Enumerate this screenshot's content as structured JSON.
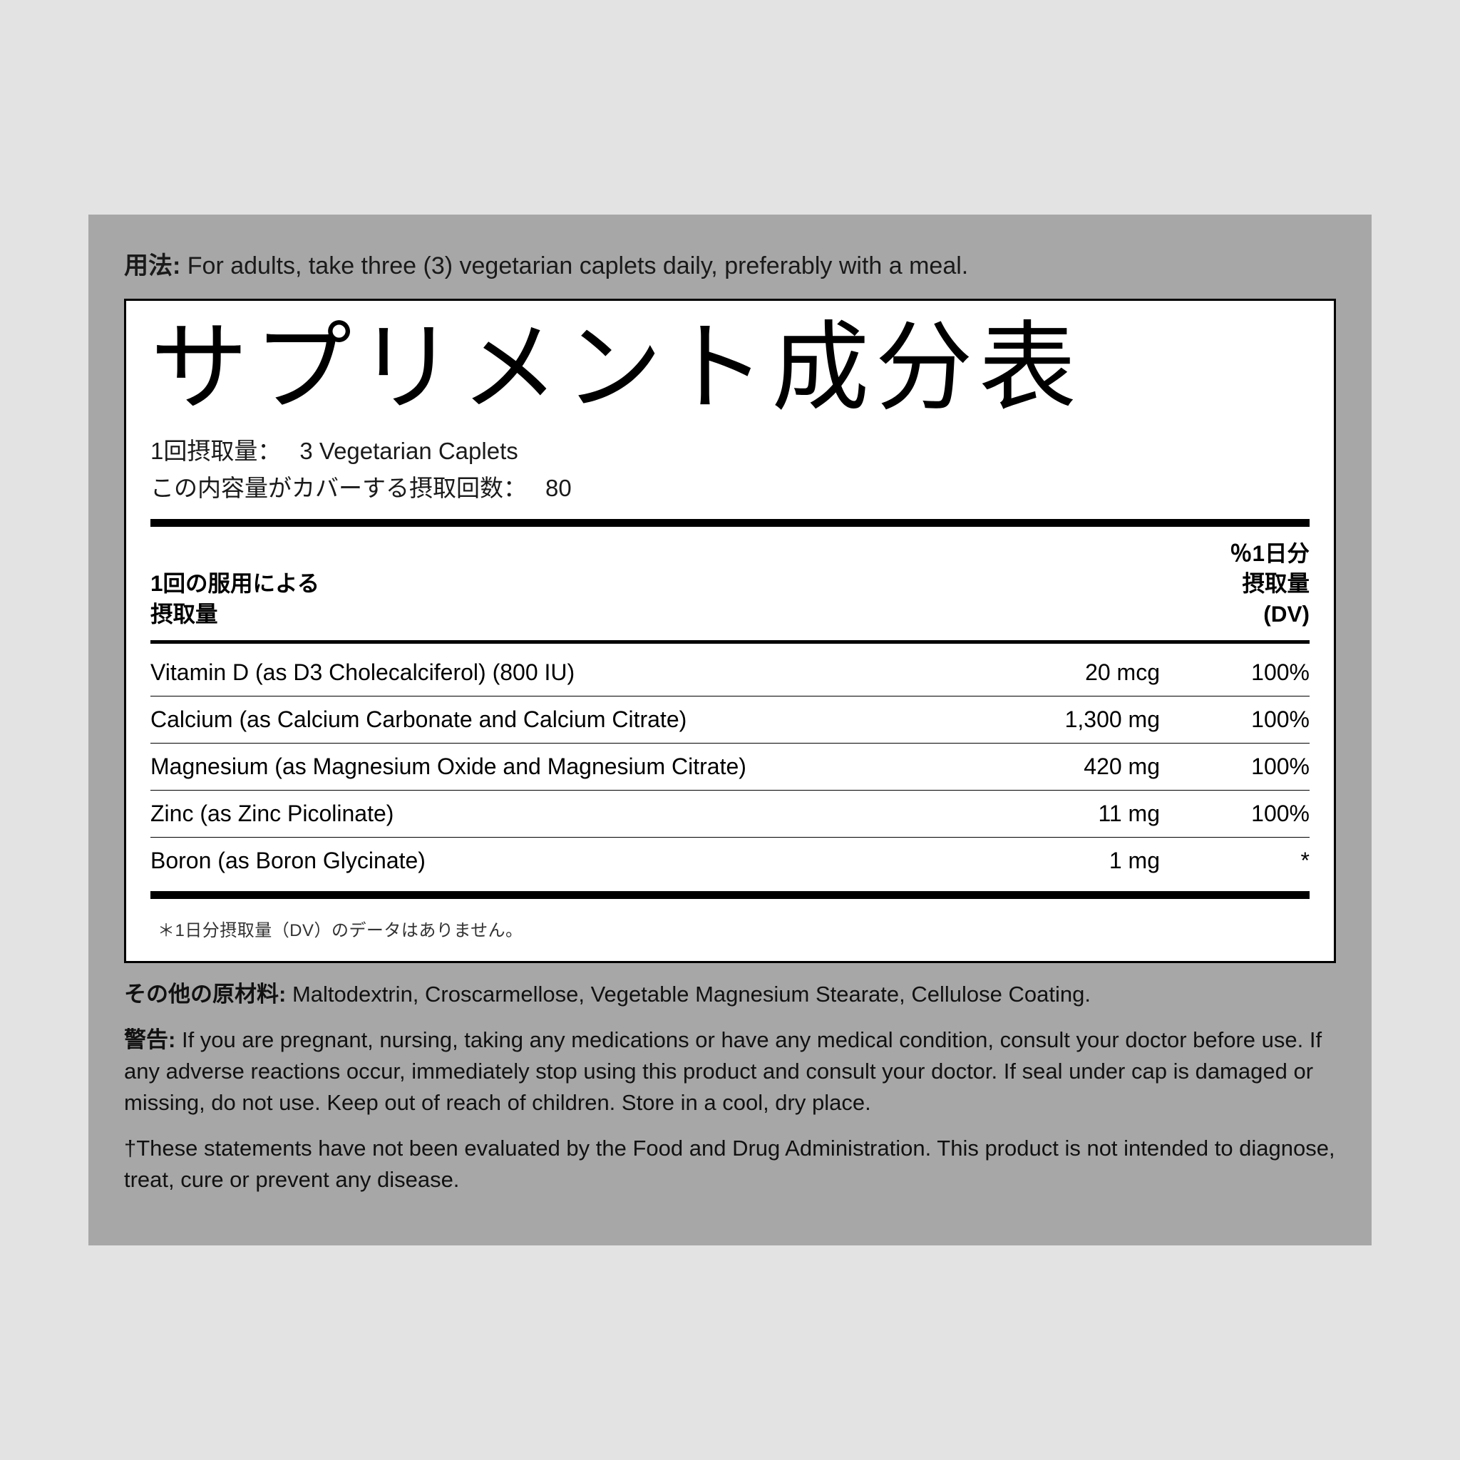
{
  "directions": {
    "label": "用法:",
    "text": "For adults, take three (3) vegetarian caplets daily, preferably with a meal."
  },
  "title": "サプリメント成分表",
  "serving": {
    "size_label": "1回摂取量：",
    "size_value": "3 Vegetarian Caplets",
    "per_container_label": "この内容量がカバーする摂取回数：",
    "per_container_value": "80"
  },
  "columns": {
    "left_line1": "1回の服用による",
    "left_line2": "摂取量",
    "right_line1": "％1日分",
    "right_line2": "摂取量",
    "right_line3": "(DV)"
  },
  "nutrients": [
    {
      "name": "Vitamin D (as D3 Cholecalciferol) (800 IU)",
      "amount": "20 mcg",
      "dv": "100%"
    },
    {
      "name": "Calcium (as Calcium Carbonate and Calcium Citrate)",
      "amount": "1,300 mg",
      "dv": "100%"
    },
    {
      "name": "Magnesium (as Magnesium Oxide and Magnesium Citrate)",
      "amount": "420 mg",
      "dv": "100%"
    },
    {
      "name": "Zinc (as Zinc Picolinate)",
      "amount": "11 mg",
      "dv": "100%"
    },
    {
      "name": "Boron (as Boron Glycinate)",
      "amount": "1 mg",
      "dv": "*"
    }
  ],
  "footnote": "＊1日分摂取量（DV）のデータはありません。",
  "other_ingredients": {
    "label": "その他の原材料:",
    "text": "Maltodextrin, Croscarmellose, Vegetable Magnesium Stearate, Cellulose Coating."
  },
  "warning": {
    "label": "警告:",
    "text": "If you are pregnant, nursing, taking any medications or have any medical condition, consult your doctor before use. If any adverse reactions occur, immediately stop using this product and consult your doctor. If seal under cap is damaged or missing, do not use. Keep out of reach of children. Store in a cool, dry place."
  },
  "disclaimer": "†These statements have not been evaluated by the Food and Drug Administration. This product is not intended to diagnose, treat, cure or prevent any disease."
}
